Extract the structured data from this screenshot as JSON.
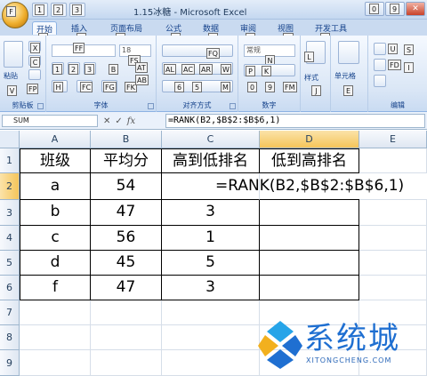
{
  "window": {
    "title": "1.15冰糖 - Microsoft Excel",
    "office_key": "F",
    "qat_keys": [
      "1",
      "2",
      "3"
    ],
    "win_keys": [
      "0",
      "9"
    ],
    "close_glyph": "✕"
  },
  "tabs": [
    {
      "label": "开始",
      "key": "H",
      "active": true
    },
    {
      "label": "插入",
      "key": "N"
    },
    {
      "label": "页面布局",
      "key": "P"
    },
    {
      "label": "公式",
      "key": "M"
    },
    {
      "label": "数据",
      "key": "A"
    },
    {
      "label": "审阅",
      "key": "R"
    },
    {
      "label": "视图",
      "key": "W"
    },
    {
      "label": "开发工具",
      "key": "L"
    }
  ],
  "ribbon": {
    "clipboard": {
      "label": "剪贴板",
      "paste": "粘贴",
      "keys": [
        "V",
        "X",
        "C",
        "FP"
      ]
    },
    "font": {
      "label": "字体",
      "font_size": "18",
      "keys": [
        "FF",
        "FS",
        "1",
        "2",
        "3",
        "B",
        "H",
        "FC",
        "FG",
        "FK",
        "AT",
        "AB"
      ]
    },
    "alignment": {
      "label": "对齐方式",
      "keys": [
        "AL",
        "AC",
        "AR",
        "W",
        "M",
        "6",
        "5",
        "FQ"
      ]
    },
    "number": {
      "label": "数字",
      "format": "常规",
      "keys": [
        "N",
        "P",
        "K",
        "0",
        "9",
        "FM"
      ]
    },
    "styles": {
      "label": "样式",
      "keys": [
        "L",
        "J"
      ]
    },
    "cells": {
      "label": "单元格",
      "keys": [
        "E"
      ]
    },
    "editing": {
      "label": "编辑",
      "keys": [
        "U",
        "FD",
        "S",
        "I"
      ]
    }
  },
  "formula_bar": {
    "name_box": "SUM",
    "cancel": "✕",
    "enter": "✓",
    "fx": "fx",
    "formula": "=RANK(B2,$B$2:$B$6,1)"
  },
  "grid": {
    "columns": [
      "A",
      "B",
      "C",
      "D",
      "E"
    ],
    "rows": [
      "1",
      "2",
      "3",
      "4",
      "5",
      "6",
      "7",
      "8",
      "9"
    ],
    "headers": [
      "班级",
      "平均分",
      "高到低排名",
      "低到高排名"
    ],
    "data": [
      [
        "a",
        "54",
        "",
        "=RANK(B2,$B$2:$B$6,1)"
      ],
      [
        "b",
        "47",
        "3",
        ""
      ],
      [
        "c",
        "56",
        "1",
        ""
      ],
      [
        "d",
        "45",
        "5",
        ""
      ],
      [
        "f",
        "47",
        "3",
        ""
      ]
    ]
  },
  "watermark": {
    "main": "系统城",
    "sub": "XITONGCHENG.COM"
  },
  "colors": {
    "accent": "#1f6fd1",
    "selected_header": "#f5c55a"
  }
}
